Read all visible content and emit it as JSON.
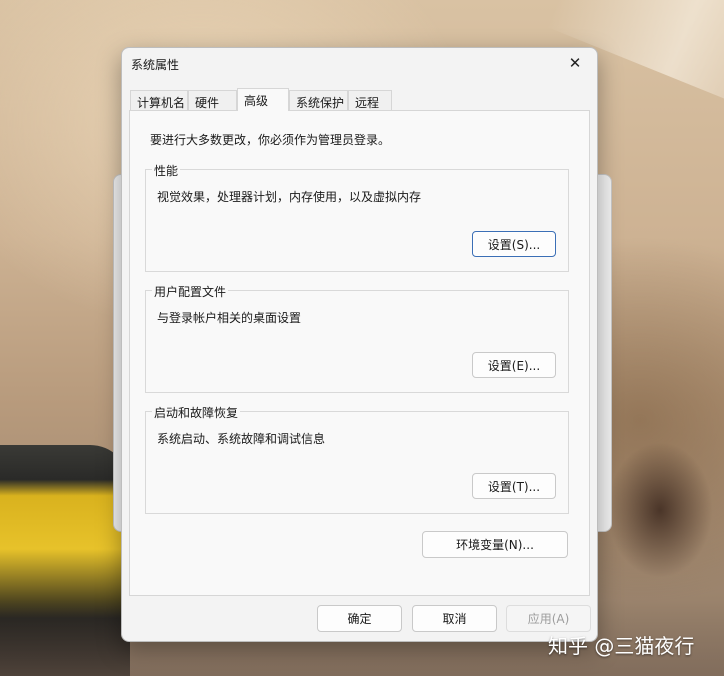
{
  "dialog": {
    "title": "系统属性",
    "close_glyph": "✕"
  },
  "tabs": [
    {
      "label": "计算机名"
    },
    {
      "label": "硬件"
    },
    {
      "label": "高级",
      "active": true
    },
    {
      "label": "系统保护"
    },
    {
      "label": "远程"
    }
  ],
  "notice": "要进行大多数更改，你必须作为管理员登录。",
  "groups": {
    "performance": {
      "title": "性能",
      "description": "视觉效果，处理器计划，内存使用，以及虚拟内存",
      "button": "设置(S)..."
    },
    "user_profiles": {
      "title": "用户配置文件",
      "description": "与登录帐户相关的桌面设置",
      "button": "设置(E)..."
    },
    "startup_recovery": {
      "title": "启动和故障恢复",
      "description": "系统启动、系统故障和调试信息",
      "button": "设置(T)..."
    }
  },
  "env_button": "环境变量(N)...",
  "footer": {
    "ok": "确定",
    "cancel": "取消",
    "apply": "应用(A)"
  },
  "watermark": "知乎 @三猫夜行",
  "colors": {
    "focus_border": "#3b6fb6",
    "dialog_bg": "#f3f3f3",
    "panel_bg": "#f9f9f9"
  }
}
